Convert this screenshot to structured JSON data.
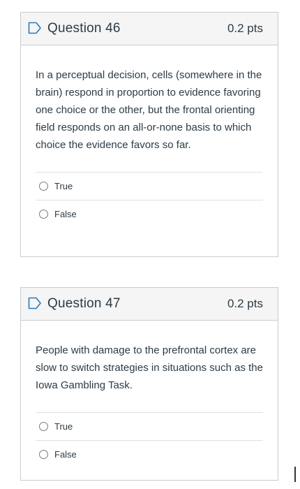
{
  "questions": [
    {
      "title": "Question 46",
      "points": "0.2 pts",
      "text": "In a perceptual decision, cells (somewhere in the brain) respond in proportion to evidence favoring one choice or the other, but the frontal orienting field responds on an all-or-none basis to which choice the evidence favors so far.",
      "answers": [
        {
          "label": "True"
        },
        {
          "label": "False"
        }
      ]
    },
    {
      "title": "Question 47",
      "points": "0.2 pts",
      "text": "People with damage to the prefrontal cortex are slow to switch strategies in situations such as the Iowa Gambling Task.",
      "answers": [
        {
          "label": "True"
        },
        {
          "label": "False"
        }
      ]
    }
  ],
  "colors": {
    "border": "#c7cdd1",
    "header_bg": "#f5f5f5",
    "flag": "#2b7abc",
    "text": "#2d3b45"
  },
  "icons": {
    "flag": "flag-question-icon",
    "radio": "radio-unselected-icon"
  }
}
